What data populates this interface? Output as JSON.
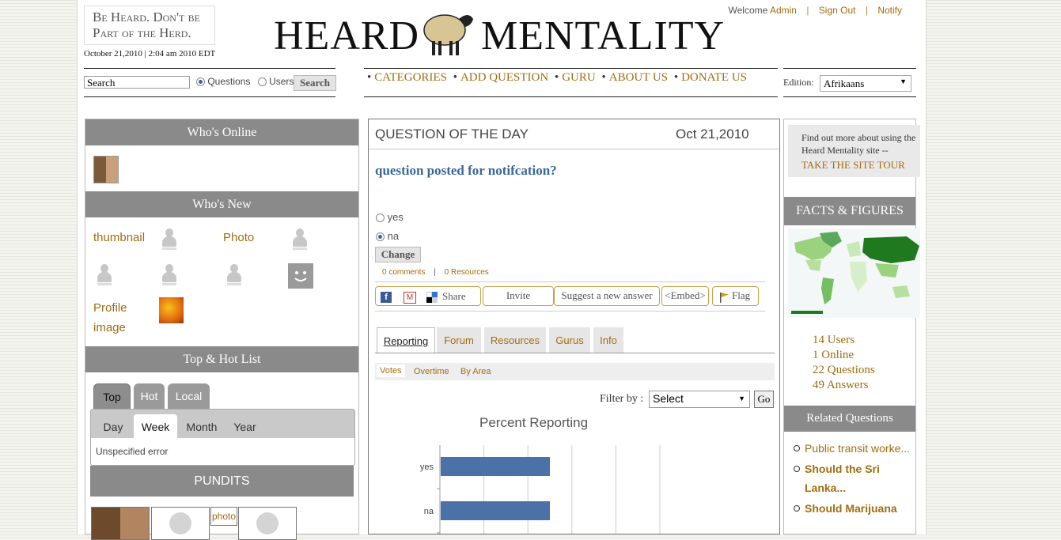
{
  "header": {
    "tagline": "Be Heard. Don't be Part of the Herd.",
    "datetime": "October 21,2010 | 2:04 am 2010 EDT",
    "logo_left": "HEARD",
    "logo_right": "MENTALITY",
    "welcome": "Welcome",
    "username": "Admin",
    "signout": "Sign Out",
    "notify": "Notify"
  },
  "search": {
    "value": "Search",
    "options": [
      "Questions",
      "Users"
    ],
    "selected": "Questions",
    "button": "Search"
  },
  "nav": {
    "items": [
      "CATEGORIES",
      "ADD QUESTION",
      "GURU",
      "ABOUT US",
      "DONATE US"
    ]
  },
  "edition": {
    "label": "Edition:",
    "value": "Afrikaans"
  },
  "left": {
    "whos_online": "Who's Online",
    "whos_new": "Who's New",
    "new_labels": [
      "thumbnail",
      "Photo",
      "Profile",
      "image"
    ],
    "top_hot_list": "Top & Hot List",
    "main_tabs": [
      "Top",
      "Hot",
      "Local"
    ],
    "sub_tabs": [
      "Day",
      "Week",
      "Month",
      "Year"
    ],
    "error_text": "Unspecified error",
    "pundits": "PUNDITS",
    "pundit_label": "photo"
  },
  "question": {
    "header": "QUESTION OF THE DAY",
    "date": "Oct 21,2010",
    "title": "question posted for notifcation?",
    "options": [
      "yes",
      "na"
    ],
    "selected": "na",
    "change_button": "Change",
    "comments": "0 comments",
    "resources": "0 Resources",
    "share": "Share",
    "invite": "Invite",
    "suggest": "Suggest a new answer",
    "embed": "<Embed>",
    "flag": "Flag",
    "tabs": [
      "Reporting",
      "Forum",
      "Resources",
      "Gurus",
      "Info"
    ],
    "subtabs": [
      "Votes",
      "Overtime",
      "By Area"
    ],
    "filter_label": "Filter by :",
    "filter_value": "Select",
    "go": "Go"
  },
  "chart_data": {
    "type": "bar",
    "title": "Percent Reporting",
    "categories": [
      "yes",
      "na"
    ],
    "values": [
      50,
      50
    ],
    "xlim": [
      0,
      100
    ],
    "grid": true
  },
  "right": {
    "tour_text": "Find out more about using the Heard Mentality site --",
    "tour_link": "TAKE THE SITE TOUR",
    "facts": "FACTS & FIGURES",
    "stats": [
      "14 Users",
      "1 Online",
      "22 Questions",
      "49 Answers"
    ],
    "related": "Related Questions",
    "related_items": [
      "Public transit worke...",
      "Should the Sri Lanka...",
      "Should Marijuana"
    ]
  },
  "colors": {
    "accent": "#a06d10",
    "bar_gray": "#8a8a8a",
    "link_blue": "#3b6699",
    "chart_bar": "#4a72a8"
  }
}
